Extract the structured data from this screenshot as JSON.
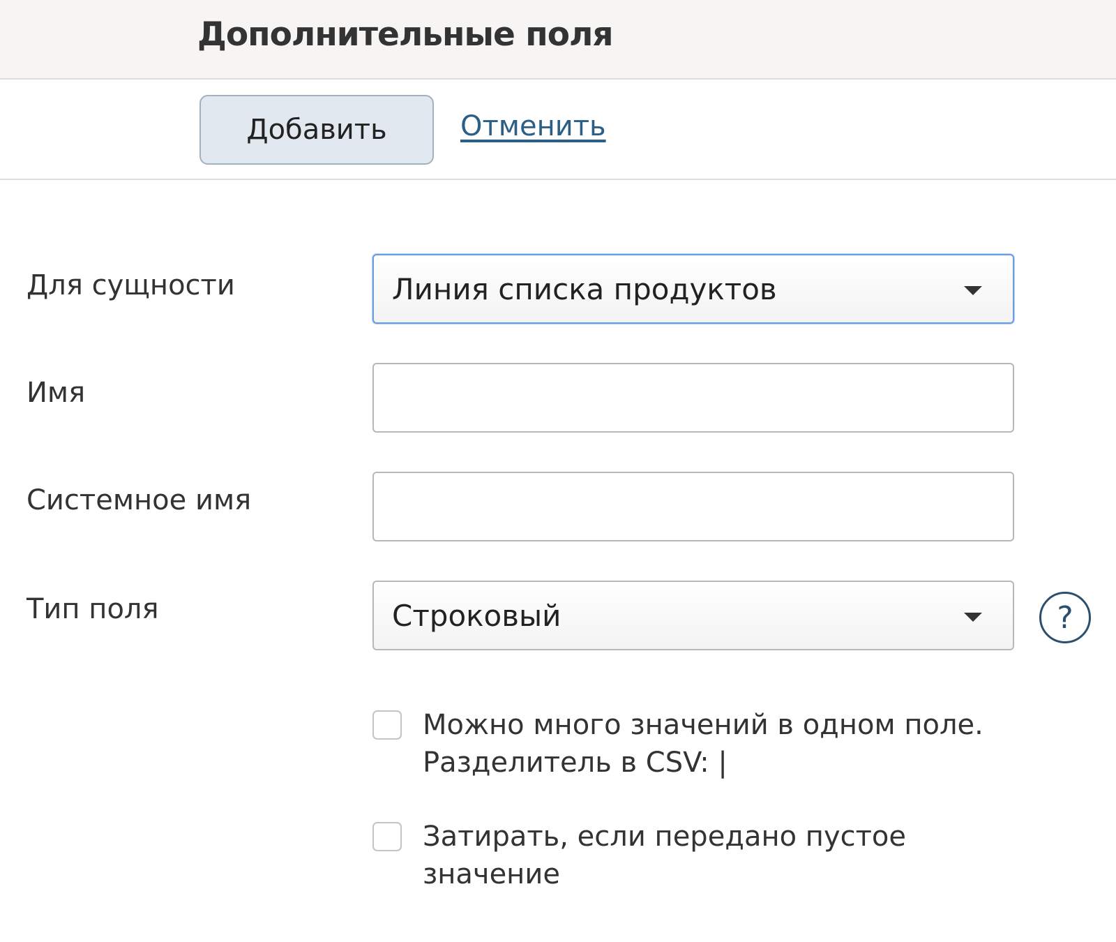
{
  "header": {
    "title": "Дополнительные поля"
  },
  "toolbar": {
    "add_label": "Добавить",
    "cancel_label": "Отменить"
  },
  "form": {
    "entity": {
      "label": "Для сущности",
      "value": "Линия списка продуктов"
    },
    "name": {
      "label": "Имя",
      "value": ""
    },
    "system_name": {
      "label": "Системное имя",
      "value": ""
    },
    "field_type": {
      "label": "Тип поля",
      "value": "Строковый",
      "help": "?"
    },
    "multi_value": {
      "checked": false,
      "line1": "Можно много значений в одном поле.",
      "line2": "Разделитель в CSV: |"
    },
    "overwrite_empty": {
      "checked": false,
      "line1": "Затирать, если передано пустое",
      "line2": "значение"
    }
  },
  "colors": {
    "header_bg": "#f6f5f3",
    "button_bg": "#e2e8ef",
    "link": "#2c5f86",
    "focus_border": "#6a9ce0",
    "help_icon": "#2c4f6e"
  }
}
